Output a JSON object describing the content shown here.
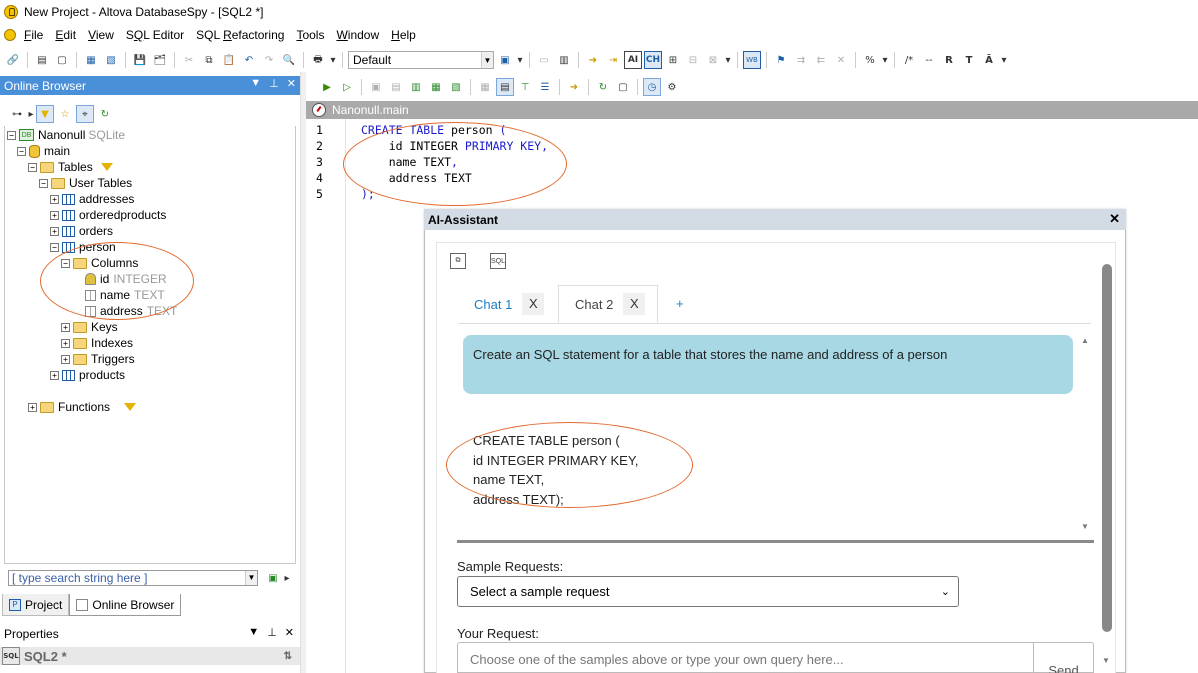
{
  "window": {
    "title": "New Project - Altova DatabaseSpy - [SQL2 *]"
  },
  "menu": [
    "File",
    "Edit",
    "View",
    "SQL Editor",
    "SQL Refactoring",
    "Tools",
    "Window",
    "Help"
  ],
  "menu_underline": [
    "F",
    "E",
    "V",
    "Q",
    "R",
    "T",
    "W",
    "H"
  ],
  "toolbar": {
    "connection_select": "Default"
  },
  "online_browser": {
    "title": "Online Browser",
    "tree": {
      "root": {
        "label": "Nanonull",
        "type": "SQLite"
      },
      "schema": "main",
      "tables_label": "Tables",
      "user_tables_label": "User Tables",
      "tables": [
        "addresses",
        "orderedproducts",
        "orders",
        "person",
        "products"
      ],
      "columns_label": "Columns",
      "columns": [
        {
          "name": "id",
          "type": "INTEGER"
        },
        {
          "name": "name",
          "type": "TEXT"
        },
        {
          "name": "address",
          "type": "TEXT"
        }
      ],
      "person_children": [
        "Keys",
        "Indexes",
        "Triggers"
      ],
      "functions_label": "Functions"
    },
    "search_placeholder": "[ type search string here ]",
    "bottom_tabs": [
      "Project",
      "Online Browser"
    ]
  },
  "properties": {
    "title": "Properties",
    "item": "SQL2 *"
  },
  "editor": {
    "tab_title": "Nanonull.main",
    "lines": [
      "1",
      "2",
      "3",
      "4",
      "5"
    ]
  },
  "ai_assistant": {
    "title": "AI-Assistant",
    "tabs": [
      {
        "label": "Chat 1",
        "close": "X"
      },
      {
        "label": "Chat 2",
        "close": "X"
      }
    ],
    "add_tab": "+",
    "user_message": "Create an SQL statement for a table that stores the name and address of a person",
    "response_lines": [
      "CREATE TABLE person (",
      "id INTEGER PRIMARY KEY,",
      "name TEXT,",
      "address TEXT);"
    ],
    "sample_requests_label": "Sample Requests:",
    "sample_select": "Select a sample request",
    "your_request_label": "Your Request:",
    "request_placeholder": "Choose one of the samples above or type your own query here...",
    "send_label": "Send"
  }
}
